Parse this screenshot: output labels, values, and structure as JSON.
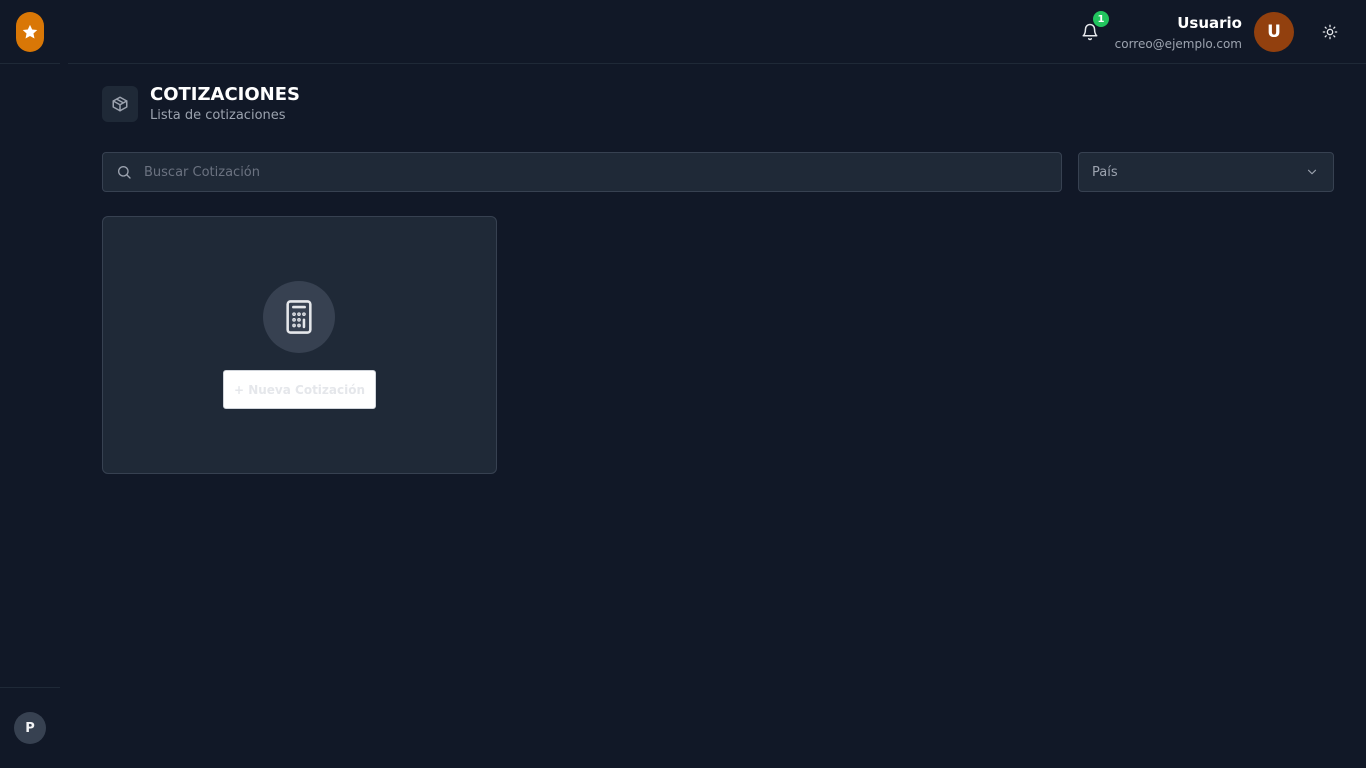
{
  "sidebar": {
    "logo_icon": "star-icon",
    "profile_initial": "P",
    "accent_color": "#d97706"
  },
  "header": {
    "notifications": {
      "icon": "bell-icon",
      "count": "1"
    },
    "user": {
      "name": "Usuario",
      "email": "correo@ejemplo.com",
      "initial": "U"
    },
    "theme_toggle_icon": "sun-icon"
  },
  "page": {
    "icon": "box-icon",
    "title": "COTIZACIONES",
    "subtitle": "Lista de cotizaciones"
  },
  "filters": {
    "search": {
      "placeholder": "Buscar Cotización",
      "value": ""
    },
    "country_select": {
      "value": "País"
    }
  },
  "card": {
    "icon": "calculator-icon",
    "button_label": "+ Nueva Cotización"
  },
  "colors": {
    "background": "#111827",
    "surface": "#1f2937",
    "border": "#374151",
    "badge": "#22c55e",
    "avatar": "#92400e"
  }
}
